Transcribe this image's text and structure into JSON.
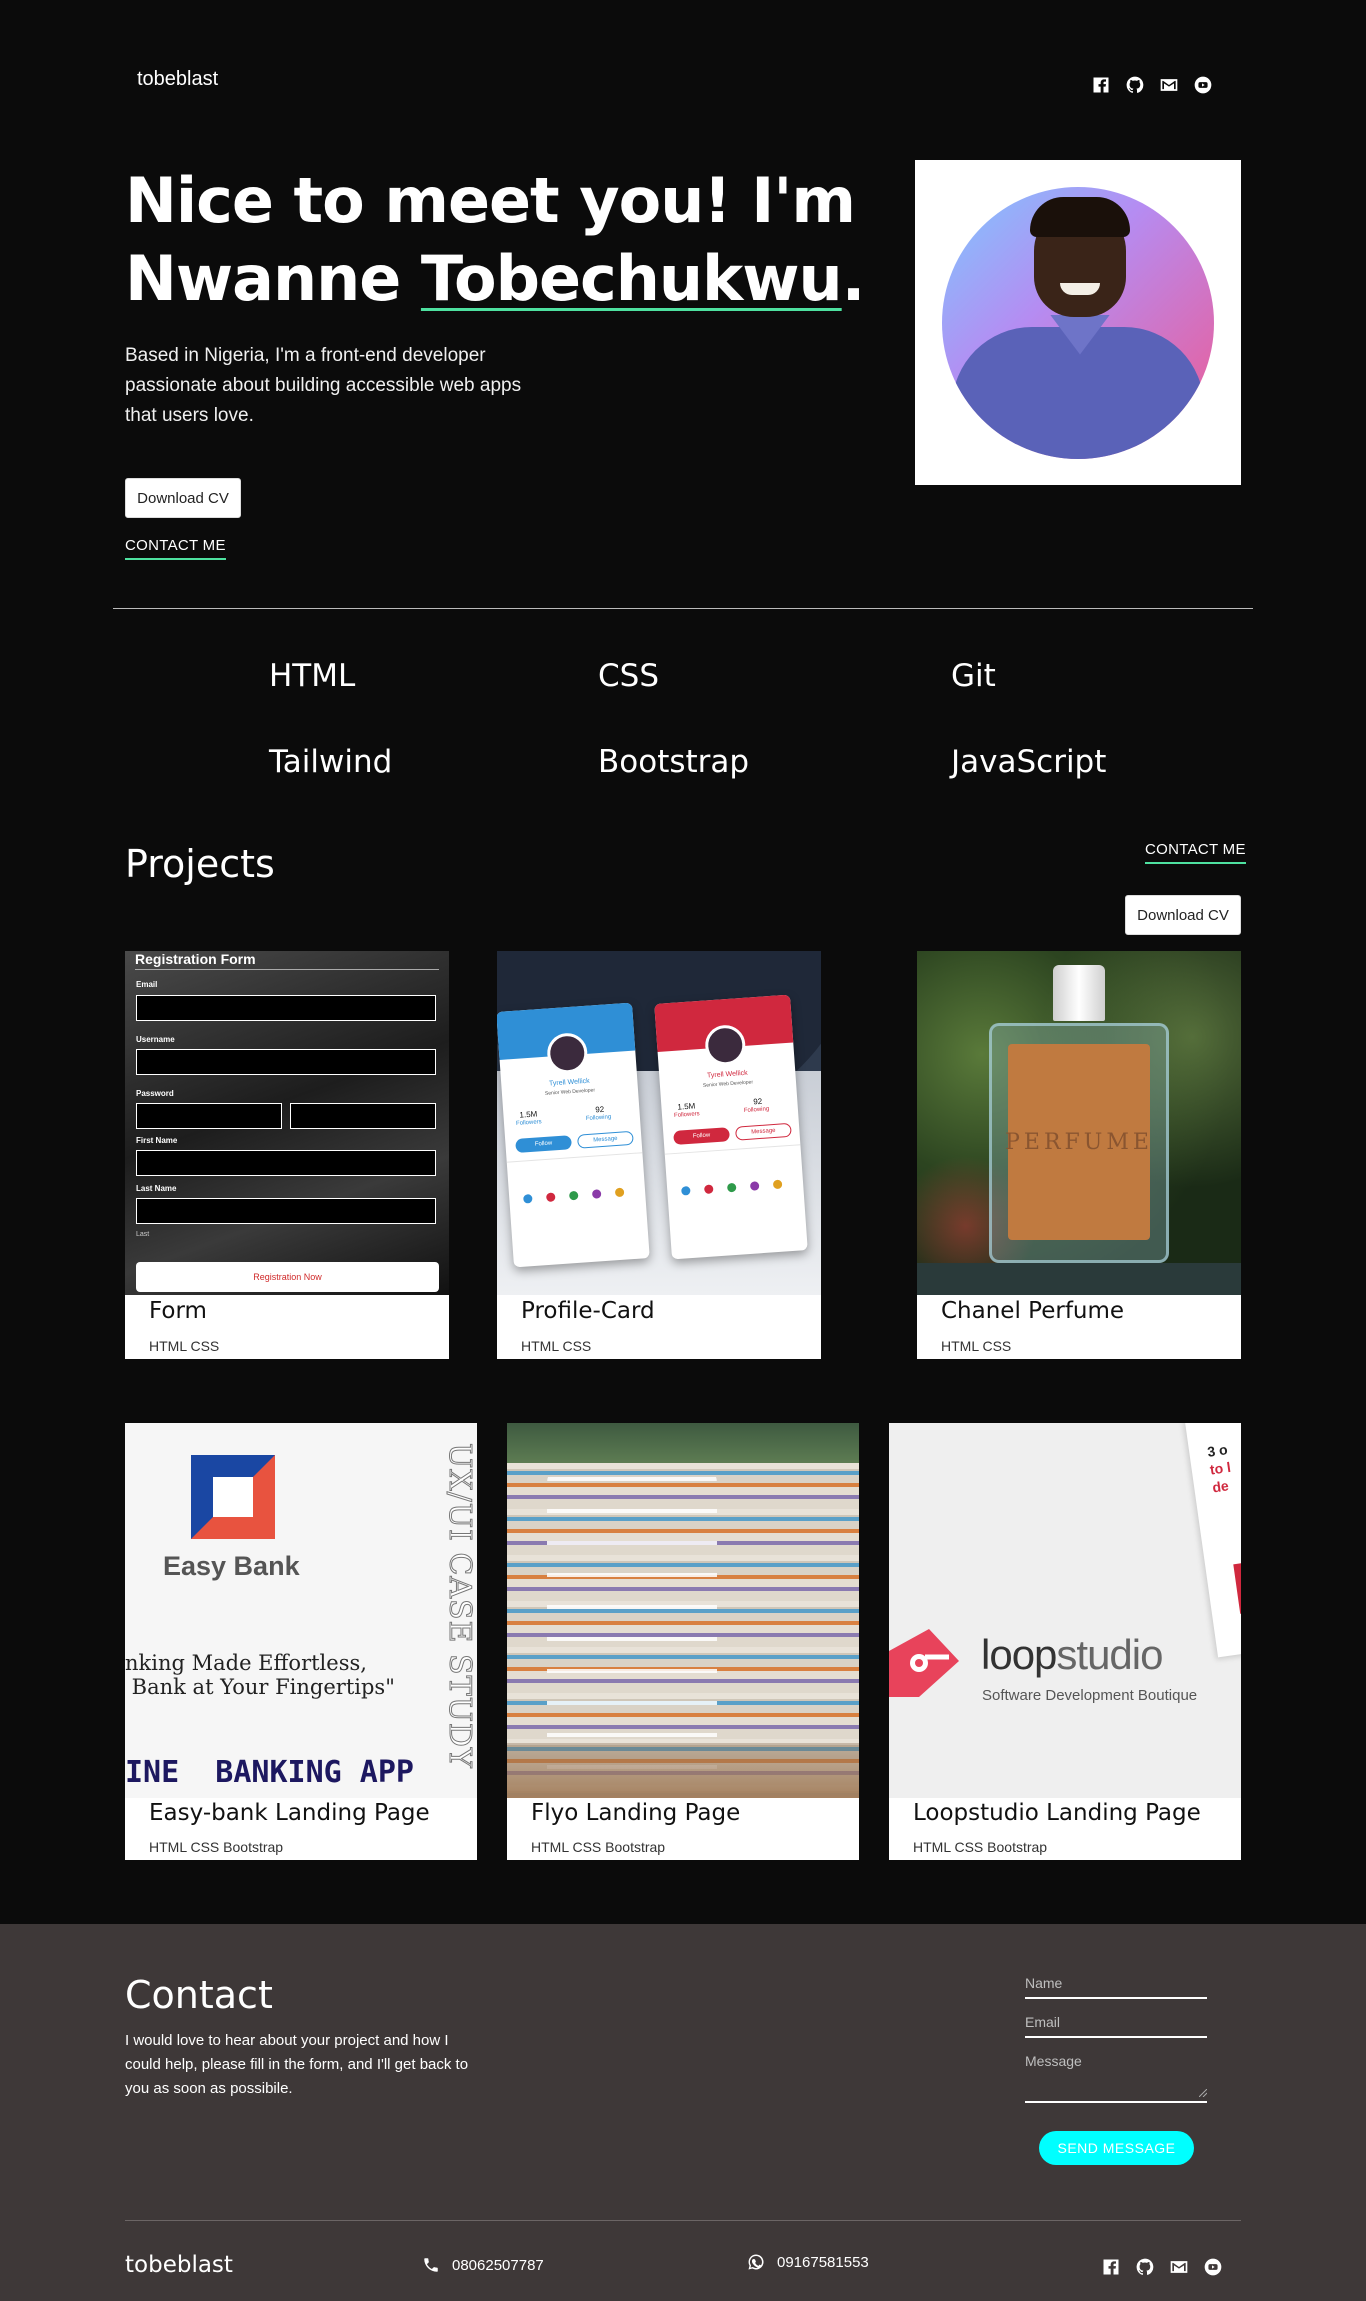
{
  "header": {
    "brand": "tobeblast",
    "social_icons": [
      "facebook-icon",
      "github-icon",
      "mail-icon",
      "youtube-icon"
    ]
  },
  "hero": {
    "title_line1": "Nice to meet you! I'm",
    "title_line2_plain": "Nwanne ",
    "title_line2_underlined": "Tobechukwu",
    "title_line2_end": ".",
    "description": "Based in Nigeria, I'm a front-end developer passionate about building accessible web apps that users love.",
    "download_cv": "Download CV",
    "contact_me": "CONTACT ME"
  },
  "skills": [
    "HTML",
    "CSS",
    "Git",
    "Tailwind",
    "Bootstrap",
    "JavaScript"
  ],
  "projects": {
    "title": "Projects",
    "contact_me": "CONTACT ME",
    "download_cv": "Download CV",
    "items": [
      {
        "title": "Form",
        "tags": "HTML CSS"
      },
      {
        "title": "Profile-Card",
        "tags": "HTML CSS"
      },
      {
        "title": "Chanel Perfume",
        "tags": "HTML CSS"
      },
      {
        "title": "Easy-bank Landing Page",
        "tags": "HTML CSS Bootstrap"
      },
      {
        "title": "Flyo Landing Page",
        "tags": "HTML CSS Bootstrap"
      },
      {
        "title": "Loopstudio Landing Page",
        "tags": "HTML CSS Bootstrap"
      }
    ],
    "thumb_text": {
      "form_title": "Registration Form",
      "form_email": "Email",
      "form_username": "Username",
      "form_password": "Password",
      "form_first_name": "First Name",
      "form_last_name": "Last Name",
      "form_last": "Last",
      "form_button": "Registration Now",
      "profile_name": "Tyrell Wellick",
      "profile_role": "Senior Web Developer",
      "profile_followers_count": "1.5M",
      "profile_followers": "Followers",
      "profile_following_count": "92",
      "profile_following": "Following",
      "profile_follow": "Follow",
      "profile_message": "Message",
      "perfume_label": "PERFUME",
      "easybank_brand": "Easy Bank",
      "easybank_quote1": "nking Made Effortless,",
      "easybank_quote2": " Bank at Your Fingertips\"",
      "easybank_app": "INE  BANKING APP",
      "easybank_vertical": "UX/UI CASE STUDY",
      "loop_brand_a": "loop",
      "loop_brand_b": "studio",
      "loop_tagline": "Software Development Boutique",
      "loop_corner1": "3 o",
      "loop_corner2": "to l",
      "loop_corner3": "de"
    }
  },
  "contact": {
    "title": "Contact",
    "description": "I would love to hear about your project and how I could help, please fill in the form, and I'll get back to you as soon as possibile.",
    "name_placeholder": "Name",
    "email_placeholder": "Email",
    "message_placeholder": "Message",
    "send_label": "SEND MESSAGE"
  },
  "footer": {
    "brand": "tobeblast",
    "phone": "08062507787",
    "whatsapp": "09167581553"
  },
  "colors": {
    "accent_green": "#4ee1a0",
    "send_button": "#00ffff",
    "contact_bg": "#3e3838"
  }
}
